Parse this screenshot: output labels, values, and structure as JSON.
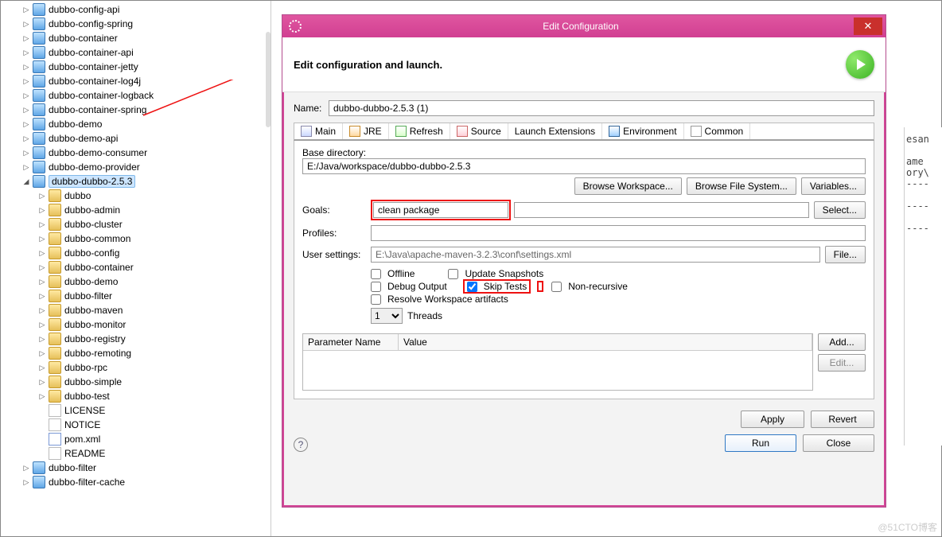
{
  "tree": {
    "items": [
      {
        "pad": 24,
        "exp": "▷",
        "icon": "pkg",
        "label": "dubbo-config-api"
      },
      {
        "pad": 24,
        "exp": "▷",
        "icon": "pkg",
        "label": "dubbo-config-spring"
      },
      {
        "pad": 24,
        "exp": "▷",
        "icon": "pkg",
        "label": "dubbo-container"
      },
      {
        "pad": 24,
        "exp": "▷",
        "icon": "pkg",
        "label": "dubbo-container-api"
      },
      {
        "pad": 24,
        "exp": "▷",
        "icon": "pkg",
        "label": "dubbo-container-jetty"
      },
      {
        "pad": 24,
        "exp": "▷",
        "icon": "pkg",
        "label": "dubbo-container-log4j"
      },
      {
        "pad": 24,
        "exp": "▷",
        "icon": "pkg",
        "label": "dubbo-container-logback"
      },
      {
        "pad": 24,
        "exp": "▷",
        "icon": "pkg",
        "label": "dubbo-container-spring"
      },
      {
        "pad": 24,
        "exp": "▷",
        "icon": "pkg",
        "label": "dubbo-demo"
      },
      {
        "pad": 24,
        "exp": "▷",
        "icon": "pkg",
        "label": "dubbo-demo-api"
      },
      {
        "pad": 24,
        "exp": "▷",
        "icon": "pkg",
        "label": "dubbo-demo-consumer"
      },
      {
        "pad": 24,
        "exp": "▷",
        "icon": "pkg",
        "label": "dubbo-demo-provider"
      },
      {
        "pad": 24,
        "exp": "◢",
        "icon": "pkg",
        "label": "dubbo-dubbo-2.5.3",
        "selected": true
      },
      {
        "pad": 44,
        "exp": "▷",
        "icon": "folder",
        "label": "dubbo"
      },
      {
        "pad": 44,
        "exp": "▷",
        "icon": "folder",
        "label": "dubbo-admin"
      },
      {
        "pad": 44,
        "exp": "▷",
        "icon": "folder",
        "label": "dubbo-cluster"
      },
      {
        "pad": 44,
        "exp": "▷",
        "icon": "folder",
        "label": "dubbo-common"
      },
      {
        "pad": 44,
        "exp": "▷",
        "icon": "folder",
        "label": "dubbo-config"
      },
      {
        "pad": 44,
        "exp": "▷",
        "icon": "folder",
        "label": "dubbo-container"
      },
      {
        "pad": 44,
        "exp": "▷",
        "icon": "folder",
        "label": "dubbo-demo"
      },
      {
        "pad": 44,
        "exp": "▷",
        "icon": "folder",
        "label": "dubbo-filter"
      },
      {
        "pad": 44,
        "exp": "▷",
        "icon": "folder",
        "label": "dubbo-maven"
      },
      {
        "pad": 44,
        "exp": "▷",
        "icon": "folder",
        "label": "dubbo-monitor"
      },
      {
        "pad": 44,
        "exp": "▷",
        "icon": "folder",
        "label": "dubbo-registry"
      },
      {
        "pad": 44,
        "exp": "▷",
        "icon": "folder",
        "label": "dubbo-remoting"
      },
      {
        "pad": 44,
        "exp": "▷",
        "icon": "folder",
        "label": "dubbo-rpc"
      },
      {
        "pad": 44,
        "exp": "▷",
        "icon": "folder",
        "label": "dubbo-simple"
      },
      {
        "pad": 44,
        "exp": "▷",
        "icon": "folder",
        "label": "dubbo-test"
      },
      {
        "pad": 44,
        "exp": "",
        "icon": "file",
        "label": "LICENSE"
      },
      {
        "pad": 44,
        "exp": "",
        "icon": "file",
        "label": "NOTICE"
      },
      {
        "pad": 44,
        "exp": "",
        "icon": "xml",
        "label": "pom.xml"
      },
      {
        "pad": 44,
        "exp": "",
        "icon": "file",
        "label": "README"
      },
      {
        "pad": 24,
        "exp": "▷",
        "icon": "pkg",
        "label": "dubbo-filter"
      },
      {
        "pad": 24,
        "exp": "▷",
        "icon": "pkg",
        "label": "dubbo-filter-cache"
      }
    ]
  },
  "dialog": {
    "title": "Edit Configuration",
    "header": "Edit configuration and launch.",
    "name_label": "Name:",
    "name_value": "dubbo-dubbo-2.5.3 (1)",
    "tabs": {
      "main": "Main",
      "jre": "JRE",
      "refresh": "Refresh",
      "source": "Source",
      "launch_ext": "Launch Extensions",
      "env": "Environment",
      "common": "Common"
    },
    "basedir_label": "Base directory:",
    "basedir_value": "E:/Java/workspace/dubbo-dubbo-2.5.3",
    "browse_ws": "Browse Workspace...",
    "browse_fs": "Browse File System...",
    "variables": "Variables...",
    "goals_label": "Goals:",
    "goals_value": "clean package",
    "select": "Select...",
    "profiles_label": "Profiles:",
    "profiles_value": "",
    "user_settings_label": "User settings:",
    "user_settings_value": "E:\\Java\\apache-maven-3.2.3\\conf\\settings.xml",
    "file": "File...",
    "chk": {
      "offline": "Offline",
      "update": "Update Snapshots",
      "debug": "Debug Output",
      "skip": "Skip Tests",
      "nonrec": "Non-recursive",
      "resolve": "Resolve Workspace artifacts"
    },
    "threads_label": "Threads",
    "threads_value": "1",
    "param_name": "Parameter Name",
    "param_value": "Value",
    "add": "Add...",
    "edit": "Edit...",
    "apply": "Apply",
    "revert": "Revert",
    "run": "Run",
    "close": "Close",
    "help": "?"
  },
  "watermark": "@51CTO博客"
}
